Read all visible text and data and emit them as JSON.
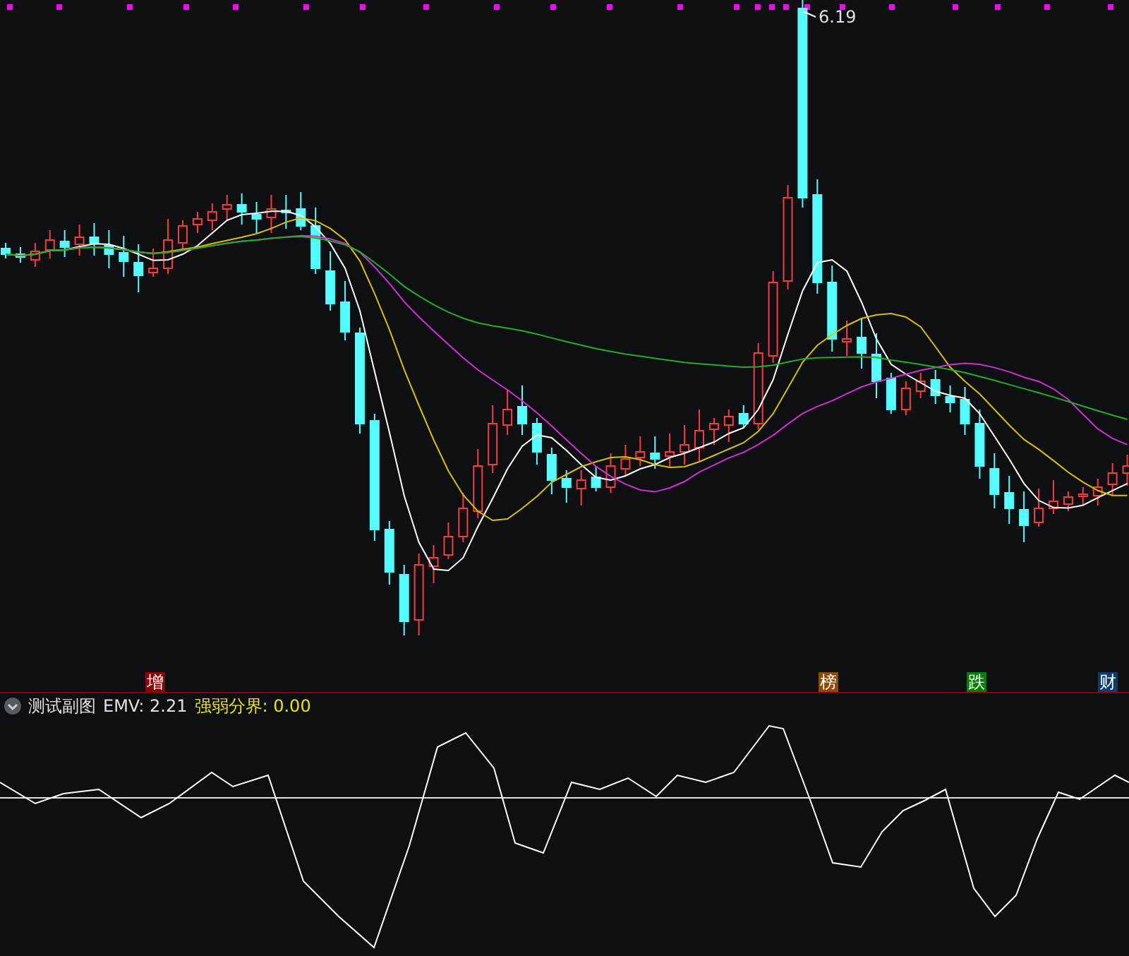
{
  "main_chart": {
    "high_label": "6.19",
    "markers": [
      {
        "label": "增",
        "color": "#8b0000"
      },
      {
        "label": "榜",
        "color": "#8b4a00"
      },
      {
        "label": "跌",
        "color": "#008000"
      },
      {
        "label": "财",
        "color": "#0a3d6b"
      }
    ]
  },
  "indicator": {
    "title": "测试副图",
    "value_label": "EMV: 2.21",
    "threshold_label": "强弱分界: 0.00"
  }
}
